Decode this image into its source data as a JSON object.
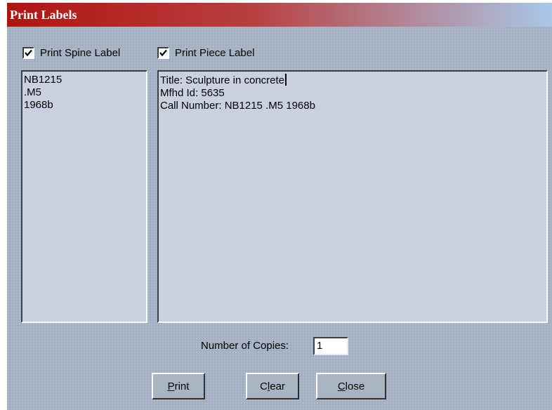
{
  "window": {
    "title": "Print Labels"
  },
  "options": {
    "spine_label": {
      "label": "Print Spine Label",
      "checked": true
    },
    "piece_label": {
      "label": "Print Piece Label",
      "checked": true
    }
  },
  "spine_text": {
    "lines": [
      "NB1215",
      ".M5",
      "1968b"
    ]
  },
  "piece_text": {
    "lines": [
      "Title: Sculpture in concrete",
      "Mfhd Id: 5635",
      "Call Number: NB1215 .M5 1968b"
    ]
  },
  "copies": {
    "label": "Number of Copies:",
    "value": "1"
  },
  "buttons": {
    "print": {
      "mnemonic": "P",
      "rest": "rint"
    },
    "clear": {
      "mnemonic": "l",
      "prefix": "C",
      "rest": "ear"
    },
    "close": {
      "mnemonic": "C",
      "rest": "lose"
    }
  },
  "colors": {
    "title_gradient_start": "#b01410",
    "title_gradient_end": "#a8c8e8",
    "dialog_background": "#a2b0c2",
    "textarea_background": "#c9d1e0"
  }
}
